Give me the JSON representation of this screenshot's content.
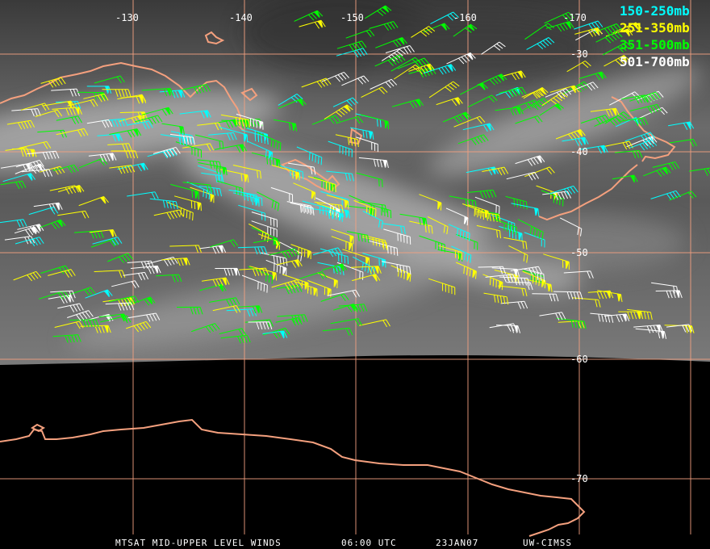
{
  "title_bar": {
    "product": "MTSAT MID-UPPER LEVEL WINDS",
    "time": "06:00 UTC",
    "date": "23JAN07",
    "credit": "UW-CIMSS"
  },
  "longitude_labels": [
    "-130",
    "-140",
    "-150",
    "-160",
    "-170"
  ],
  "latitude_labels": [
    "-30",
    "-40",
    "-50",
    "-60",
    "-70"
  ],
  "legend": [
    {
      "label": "150-250mb",
      "color": "#00ffff"
    },
    {
      "label": "251-350mb",
      "color": "#ffff00"
    },
    {
      "label": "351-500mb",
      "color": "#00ff00"
    },
    {
      "label": "501-700mb",
      "color": "#ffffff"
    }
  ],
  "colors": {
    "grid": "#f2a080",
    "coastline": "#f4a07e",
    "background": "#000000"
  }
}
